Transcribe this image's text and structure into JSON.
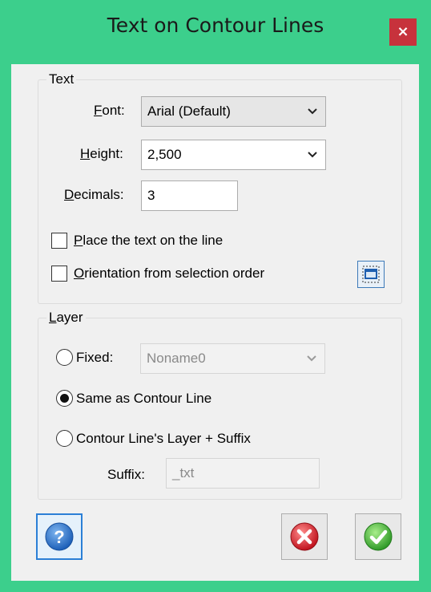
{
  "window": {
    "title": "Text on Contour Lines",
    "close_label": "×"
  },
  "text_group": {
    "legend": "Text",
    "font_label_u": "F",
    "font_label_rest": "ont:",
    "font_value": "Arial (Default)",
    "height_label_u": "H",
    "height_label_rest": "eight:",
    "height_value": "2,500",
    "decimals_label_u": "D",
    "decimals_label_rest": "ecimals:",
    "decimals_value": "3",
    "place_on_line_u": "P",
    "place_on_line_rest": "lace the text on the line",
    "orientation_u": "O",
    "orientation_rest": "rientation from selection order"
  },
  "layer_group": {
    "legend_u": "L",
    "legend_rest": "ayer",
    "fixed_label": "Fixed:",
    "fixed_value": "Noname0",
    "same_as_label": "Same as Contour Line",
    "layer_suffix_label": "Contour Line's Layer + Suffix",
    "suffix_label": "Suffix:",
    "suffix_value": "_txt"
  },
  "state": {
    "place_on_line_checked": false,
    "orientation_checked": false,
    "layer_mode": "same_as_contour_line"
  },
  "colors": {
    "title_bar": "#3ccf8c",
    "close_button": "#c7323c",
    "help_blue": "#2a6fc9",
    "cancel_red": "#d9303a",
    "ok_green": "#3fb53a"
  },
  "icons": {
    "help": "question-icon",
    "cancel": "cancel-icon",
    "ok": "check-icon",
    "select_window": "window-select-icon"
  }
}
